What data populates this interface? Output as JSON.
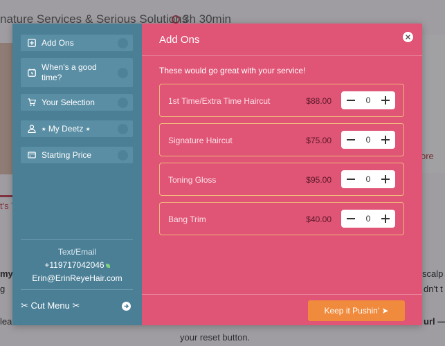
{
  "background": {
    "page_title": "nature Services & Serious Solutions",
    "duration": "3h 30min",
    "more_link": "ore",
    "tab_fragment": "t's T",
    "left_fragments": [
      "my",
      "g",
      "lea"
    ],
    "right_fragments": [
      "scalp",
      "dn't t",
      "url —"
    ],
    "reset_text": "your reset button."
  },
  "sidebar": {
    "steps": [
      {
        "label": "Add Ons",
        "icon": "plus-square-icon"
      },
      {
        "label": "When's a good time?",
        "icon": "calendar-clock-icon"
      },
      {
        "label": "Your Selection",
        "icon": "cart-icon"
      },
      {
        "label": "⭑ My Deetz ⭑",
        "icon": "user-icon"
      },
      {
        "label": "Starting Price",
        "icon": "card-icon"
      }
    ],
    "contact_label": "Text/Email",
    "phone": "+119717042046",
    "email": "Erin@ErinReyeHair.com",
    "cut_menu_label": "✂ Cut Menu ✂"
  },
  "main": {
    "title": "Add Ons",
    "subtitle": "These would go great with your service!",
    "addons": [
      {
        "name": "1st Time/Extra Time Haircut",
        "price": "$88.00",
        "qty": "0"
      },
      {
        "name": "Signature Haircut",
        "price": "$75.00",
        "qty": "0"
      },
      {
        "name": "Toning Gloss",
        "price": "$95.00",
        "qty": "0"
      },
      {
        "name": "Bang Trim",
        "price": "$40.00",
        "qty": "0"
      }
    ],
    "continue_label": "Keep it Pushin' ➤"
  },
  "colors": {
    "sidebar": "#4a7f96",
    "main": "#e05476",
    "button": "#f08a3c",
    "border": "#f2b97c"
  }
}
